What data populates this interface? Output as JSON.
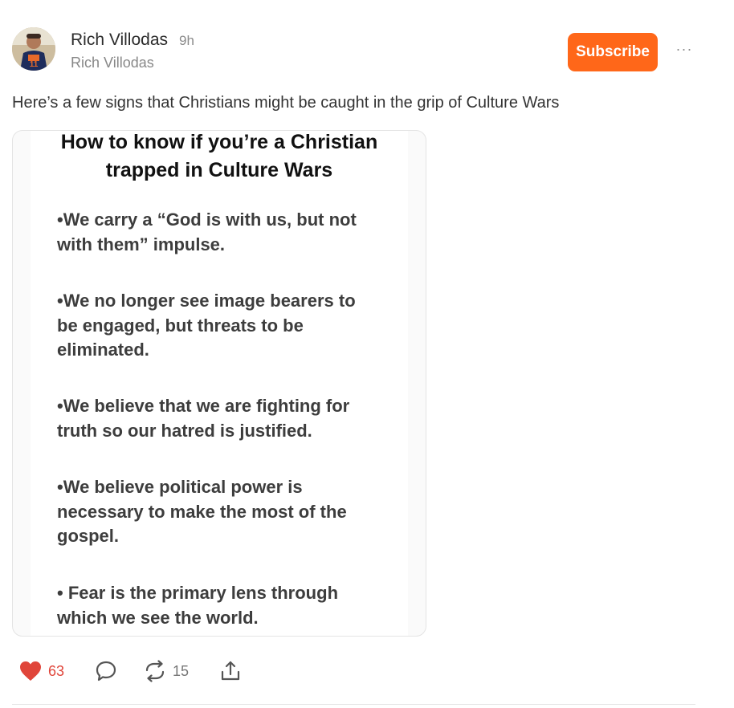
{
  "post": {
    "author": {
      "name": "Rich Villodas",
      "time": "9h",
      "publication": "Rich Villodas"
    },
    "subscribe_label": "Subscribe",
    "more_label": "···",
    "text": "Here’s a few signs that Christians might be caught in the grip of Culture Wars",
    "image": {
      "title_line1": "How to know if you’re a Christian",
      "title_line2": "trapped in Culture Wars",
      "bullets": [
        [
          "•We carry a “God is with us, but not",
          "with them” impulse."
        ],
        [
          "•We no longer see image bearers to",
          "be engaged, but threats to be",
          "eliminated."
        ],
        [
          "•We believe that we are fighting for",
          "truth so our hatred is justified."
        ],
        [
          "•We believe political power is",
          "necessary to make the most of the",
          "gospel."
        ],
        [
          "• Fear is the primary lens through",
          "which we see the world."
        ]
      ]
    },
    "actions": {
      "likes": "63",
      "comments": "",
      "restacks": "15",
      "share": ""
    }
  },
  "colors": {
    "subscribe_bg": "#ff6719",
    "heart": "#e0453a",
    "icon_gray": "#555555"
  },
  "icons": [
    "heart-icon",
    "comment-icon",
    "restack-icon",
    "share-icon",
    "more-icon"
  ]
}
